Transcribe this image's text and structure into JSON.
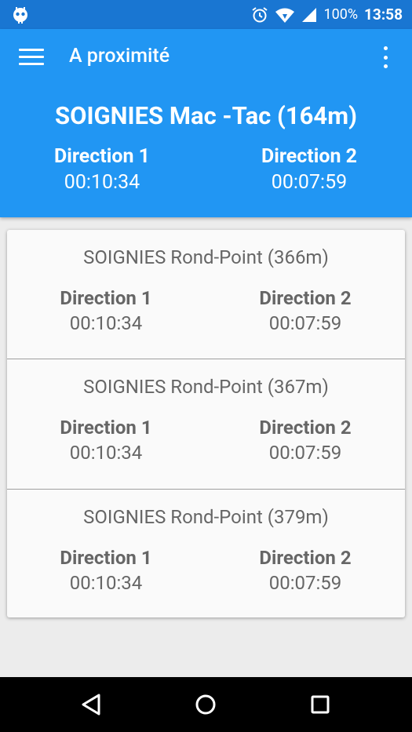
{
  "status_bar": {
    "battery": "100%",
    "time": "13:58"
  },
  "app_bar": {
    "title": "A proximité"
  },
  "nearest": {
    "name": "SOIGNIES Mac -Tac (164m)",
    "direction1_label": "Direction 1",
    "direction1_time": "00:10:34",
    "direction2_label": "Direction 2",
    "direction2_time": "00:07:59"
  },
  "stops": [
    {
      "name": "SOIGNIES Rond-Point (366m)",
      "direction1_label": "Direction 1",
      "direction1_time": "00:10:34",
      "direction2_label": "Direction 2",
      "direction2_time": "00:07:59"
    },
    {
      "name": "SOIGNIES Rond-Point (367m)",
      "direction1_label": "Direction 1",
      "direction1_time": "00:10:34",
      "direction2_label": "Direction 2",
      "direction2_time": "00:07:59"
    },
    {
      "name": "SOIGNIES Rond-Point (379m)",
      "direction1_label": "Direction 1",
      "direction1_time": "00:10:34",
      "direction2_label": "Direction 2",
      "direction2_time": "00:07:59"
    }
  ],
  "colors": {
    "status_bar": "#1976d2",
    "app_bar": "#2196f3",
    "card_text": "#666666",
    "nav_bar": "#000000"
  },
  "icons": {
    "status_left": "android-robot-icon",
    "alarm": "alarm-clock-icon",
    "wifi": "wifi-icon",
    "signal": "cell-signal-icon",
    "menu": "hamburger-menu-icon",
    "more": "more-vert-icon",
    "back": "back-triangle-icon",
    "home": "home-circle-icon",
    "recents": "recents-square-icon"
  }
}
